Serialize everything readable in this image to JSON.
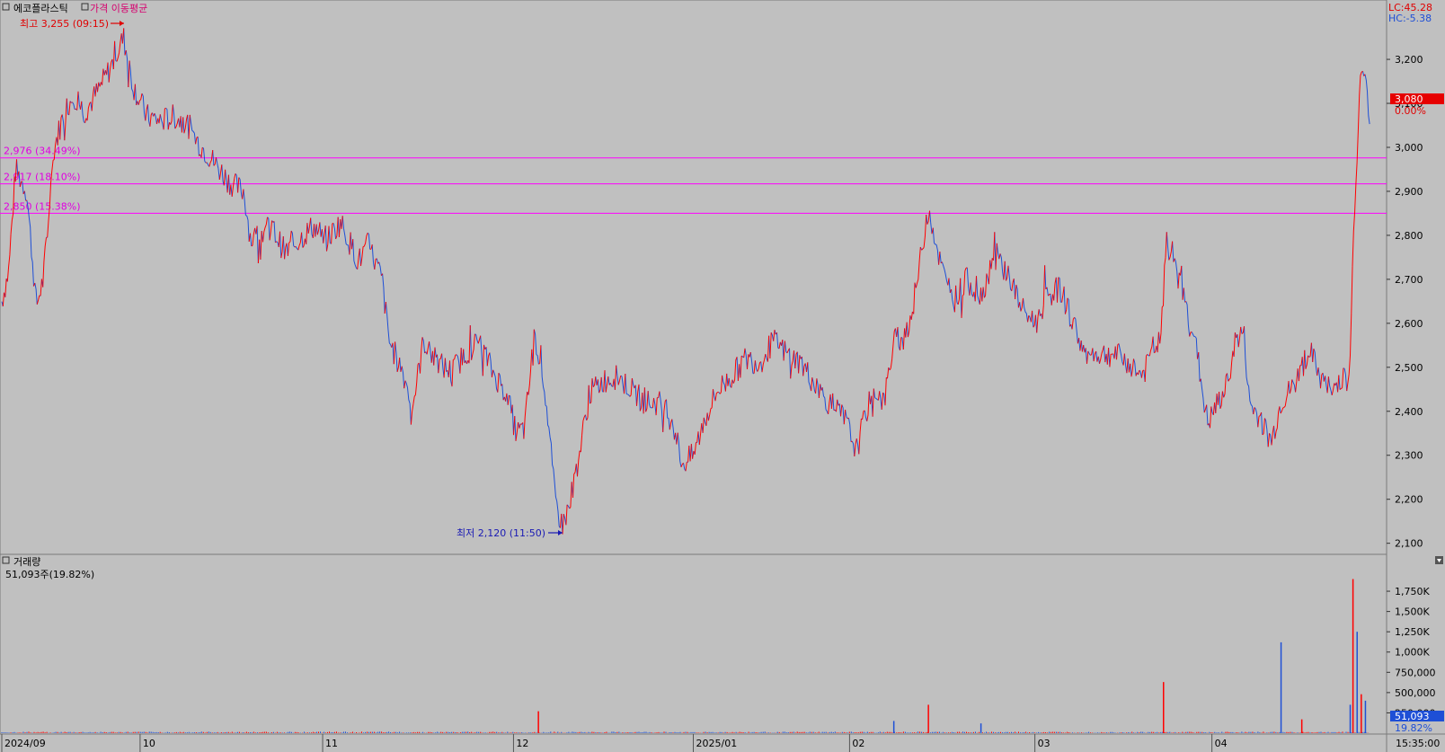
{
  "colors": {
    "background": "#c0c0c0",
    "up": "#ff0000",
    "down": "#1e4fd6",
    "support_line": "#ff00ff",
    "price_badge": "#e60000",
    "volume_badge": "#1e4fd6"
  },
  "price_panel": {
    "title": "에코플라스틱",
    "indicator_label": "가격 이동평균",
    "corner_lc": "LC:45.28",
    "corner_hc": "HC:-5.38",
    "high_label": "최고 3,255 (09:15)",
    "low_label": "최저 2,120 (11:50)",
    "current_price": "3,080",
    "current_change": "0.00%",
    "close_icon": "close-icon"
  },
  "volume_panel": {
    "title": "거래량",
    "subtitle": "51,093주(19.82%)",
    "current_volume": "51,093",
    "current_ratio": "19.82%",
    "collapse_icon": "collapse-icon"
  },
  "time_axis_label": "15:35:00",
  "chart_data": [
    {
      "type": "line",
      "title": "에코플라스틱",
      "y_ticks": [
        3200,
        3100,
        3000,
        2900,
        2800,
        2700,
        2600,
        2500,
        2400,
        2300,
        2200,
        2100
      ],
      "y_tick_labels": [
        "3,200",
        "3,100",
        "3,000",
        "2,900",
        "2,800",
        "2,700",
        "2,600",
        "2,500",
        "2,400",
        "2,300",
        "2,200",
        "2,100"
      ],
      "ylim": [
        2085,
        3290
      ],
      "x_tick_labels": [
        "2024/09",
        "10",
        "11",
        "12",
        "2025/01",
        "02",
        "03",
        "04"
      ],
      "x_tick_fracs": [
        0.0,
        0.1,
        0.232,
        0.37,
        0.5,
        0.613,
        0.747,
        0.875
      ],
      "series": [
        {
          "anchors": [
            [
              0.0,
              2650
            ],
            [
              0.005,
              2720
            ],
            [
              0.01,
              2950
            ],
            [
              0.018,
              2900
            ],
            [
              0.025,
              2640
            ],
            [
              0.03,
              2700
            ],
            [
              0.038,
              3000
            ],
            [
              0.045,
              3080
            ],
            [
              0.052,
              3120
            ],
            [
              0.06,
              3080
            ],
            [
              0.07,
              3130
            ],
            [
              0.08,
              3190
            ],
            [
              0.088,
              3250
            ],
            [
              0.095,
              3140
            ],
            [
              0.105,
              3070
            ],
            [
              0.115,
              3060
            ],
            [
              0.125,
              3070
            ],
            [
              0.135,
              3050
            ],
            [
              0.14,
              3020
            ],
            [
              0.155,
              2960
            ],
            [
              0.165,
              2920
            ],
            [
              0.175,
              2900
            ],
            [
              0.18,
              2790
            ],
            [
              0.195,
              2820
            ],
            [
              0.205,
              2760
            ],
            [
              0.215,
              2790
            ],
            [
              0.225,
              2820
            ],
            [
              0.235,
              2790
            ],
            [
              0.245,
              2830
            ],
            [
              0.258,
              2740
            ],
            [
              0.265,
              2780
            ],
            [
              0.275,
              2700
            ],
            [
              0.28,
              2560
            ],
            [
              0.29,
              2490
            ],
            [
              0.297,
              2410
            ],
            [
              0.305,
              2560
            ],
            [
              0.315,
              2510
            ],
            [
              0.325,
              2490
            ],
            [
              0.335,
              2530
            ],
            [
              0.345,
              2560
            ],
            [
              0.355,
              2490
            ],
            [
              0.365,
              2440
            ],
            [
              0.372,
              2350
            ],
            [
              0.378,
              2360
            ],
            [
              0.385,
              2570
            ],
            [
              0.39,
              2520
            ],
            [
              0.395,
              2380
            ],
            [
              0.4,
              2200
            ],
            [
              0.405,
              2140
            ],
            [
              0.41,
              2180
            ],
            [
              0.418,
              2310
            ],
            [
              0.425,
              2440
            ],
            [
              0.435,
              2470
            ],
            [
              0.445,
              2480
            ],
            [
              0.455,
              2450
            ],
            [
              0.465,
              2420
            ],
            [
              0.475,
              2420
            ],
            [
              0.485,
              2380
            ],
            [
              0.492,
              2280
            ],
            [
              0.5,
              2300
            ],
            [
              0.508,
              2380
            ],
            [
              0.518,
              2450
            ],
            [
              0.528,
              2480
            ],
            [
              0.538,
              2520
            ],
            [
              0.548,
              2510
            ],
            [
              0.558,
              2560
            ],
            [
              0.568,
              2530
            ],
            [
              0.578,
              2510
            ],
            [
              0.588,
              2460
            ],
            [
              0.598,
              2420
            ],
            [
              0.61,
              2380
            ],
            [
              0.618,
              2310
            ],
            [
              0.625,
              2400
            ],
            [
              0.632,
              2450
            ],
            [
              0.638,
              2420
            ],
            [
              0.645,
              2560
            ],
            [
              0.652,
              2570
            ],
            [
              0.658,
              2620
            ],
            [
              0.665,
              2760
            ],
            [
              0.67,
              2870
            ],
            [
              0.675,
              2790
            ],
            [
              0.68,
              2720
            ],
            [
              0.688,
              2650
            ],
            [
              0.698,
              2700
            ],
            [
              0.708,
              2660
            ],
            [
              0.718,
              2760
            ],
            [
              0.728,
              2710
            ],
            [
              0.738,
              2630
            ],
            [
              0.748,
              2600
            ],
            [
              0.755,
              2660
            ],
            [
              0.765,
              2680
            ],
            [
              0.775,
              2600
            ],
            [
              0.783,
              2530
            ],
            [
              0.795,
              2530
            ],
            [
              0.805,
              2530
            ],
            [
              0.815,
              2510
            ],
            [
              0.825,
              2480
            ],
            [
              0.832,
              2540
            ],
            [
              0.838,
              2560
            ],
            [
              0.842,
              2780
            ],
            [
              0.848,
              2750
            ],
            [
              0.855,
              2650
            ],
            [
              0.862,
              2580
            ],
            [
              0.868,
              2450
            ],
            [
              0.872,
              2370
            ],
            [
              0.878,
              2410
            ],
            [
              0.885,
              2450
            ],
            [
              0.892,
              2560
            ],
            [
              0.898,
              2580
            ],
            [
              0.902,
              2420
            ],
            [
              0.91,
              2380
            ],
            [
              0.918,
              2330
            ],
            [
              0.925,
              2420
            ],
            [
              0.935,
              2460
            ],
            [
              0.945,
              2540
            ],
            [
              0.955,
              2470
            ],
            [
              0.962,
              2440
            ],
            [
              0.968,
              2480
            ],
            [
              0.974,
              2460
            ],
            [
              0.977,
              2750
            ],
            [
              0.98,
              3000
            ],
            [
              0.983,
              3180
            ],
            [
              0.986,
              3140
            ],
            [
              0.989,
              3080
            ]
          ],
          "points": 1200
        }
      ],
      "support_lines": [
        {
          "value": 2976,
          "label": "2,976 (34.49%)"
        },
        {
          "value": 2917,
          "label": "2,917 (18.10%)"
        },
        {
          "value": 2850,
          "label": "2,850 (15.38%)"
        }
      ]
    },
    {
      "type": "bar",
      "title": "거래량",
      "y_ticks": [
        1750000,
        1500000,
        1250000,
        1000000,
        750000,
        500000,
        250000
      ],
      "y_tick_labels": [
        "1,750K",
        "1,500K",
        "1,250K",
        "1,000K",
        "750,000",
        "500,000",
        "250,000"
      ],
      "ylim": [
        0,
        1950000
      ],
      "spikes": [
        [
          0.388,
          270000
        ],
        [
          0.645,
          150000
        ],
        [
          0.67,
          350000
        ],
        [
          0.708,
          120000
        ],
        [
          0.84,
          630000
        ],
        [
          0.925,
          1120000
        ],
        [
          0.94,
          170000
        ],
        [
          0.975,
          350000
        ],
        [
          0.977,
          1900000
        ],
        [
          0.98,
          1250000
        ],
        [
          0.983,
          480000
        ],
        [
          0.986,
          400000
        ]
      ]
    }
  ]
}
